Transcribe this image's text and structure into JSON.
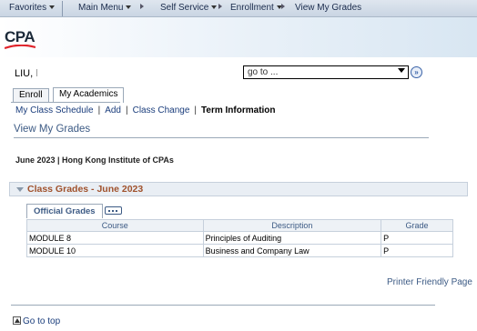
{
  "nav": {
    "favorites": "Favorites",
    "main_menu": "Main Menu",
    "self_service": "Self Service",
    "enrollment": "Enrollment",
    "current": "View My Grades"
  },
  "brand": {
    "logo_text": "CPA"
  },
  "user": {
    "name": "LIU,",
    "name_tail": "l"
  },
  "goto": {
    "value": "go to ...",
    "button_label": "»"
  },
  "tabs": [
    {
      "label": "Enroll"
    },
    {
      "label": "My Academics"
    }
  ],
  "subnav": [
    {
      "label": "My Class Schedule"
    },
    {
      "label": "Add"
    },
    {
      "label": "Class Change"
    },
    {
      "label": "Term Information"
    }
  ],
  "page": {
    "title": "View My Grades",
    "term": "June 2023 | Hong Kong Institute of CPAs"
  },
  "section": {
    "label": "Class Grades - June 2023"
  },
  "grades_tab": {
    "label": "Official Grades"
  },
  "table": {
    "headers": [
      "Course",
      "Description",
      "Grade"
    ],
    "rows": [
      {
        "course": "MODULE 8",
        "description": "Principles of Auditing",
        "grade": "P"
      },
      {
        "course": "MODULE 10",
        "description": "Business and Company Law",
        "grade": "P"
      }
    ]
  },
  "footer": {
    "printer": "Printer Friendly Page",
    "go_top": "Go to top"
  },
  "colors": {
    "accent": "#3c5a84",
    "section_label": "#a0522d"
  }
}
